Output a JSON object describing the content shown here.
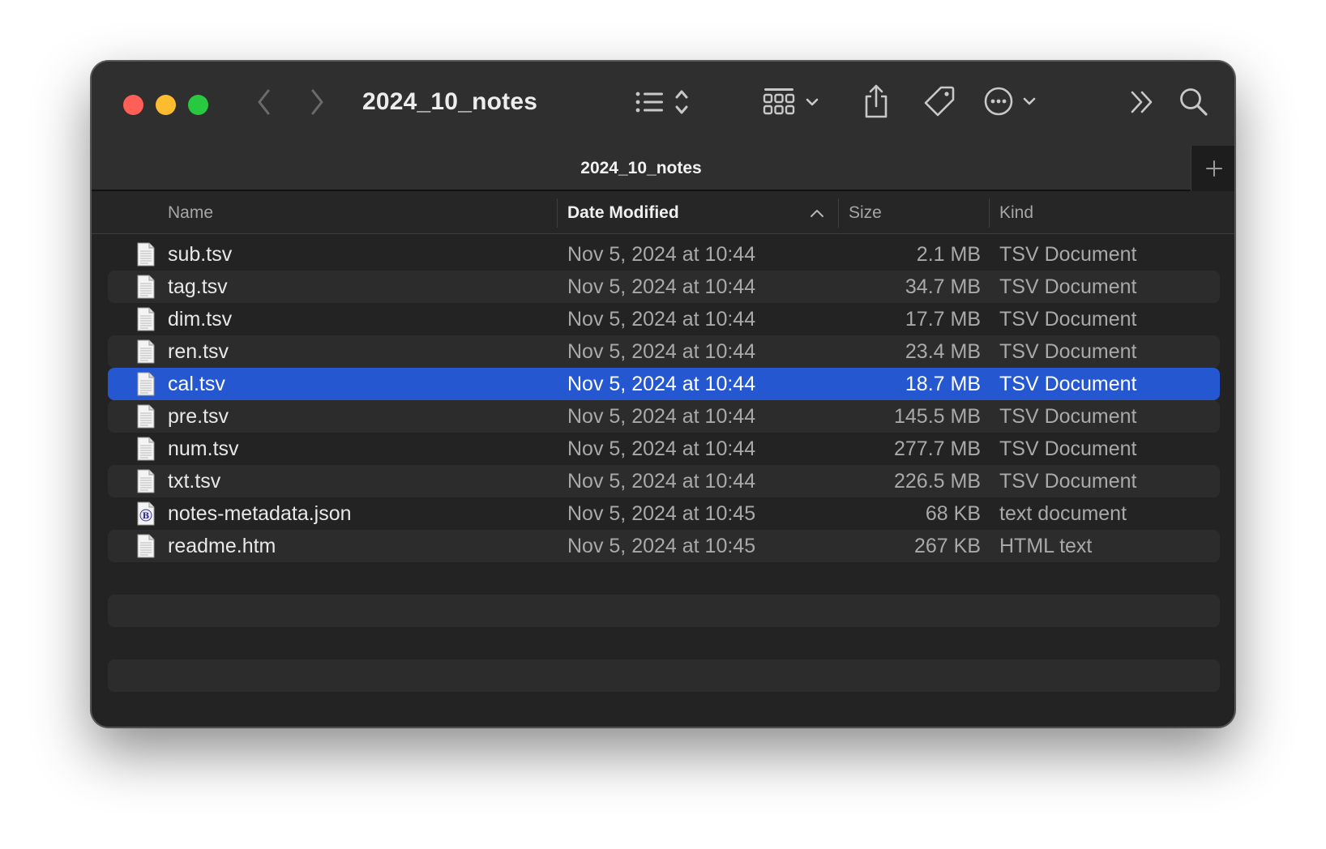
{
  "window": {
    "title": "2024_10_notes"
  },
  "toolbar": {
    "buttons": [
      {
        "name": "back",
        "icon": "chevron-left-icon"
      },
      {
        "name": "forward",
        "icon": "chevron-right-icon"
      },
      {
        "name": "view-list",
        "icon": "list-view-icon"
      },
      {
        "name": "group",
        "icon": "grid-group-icon"
      },
      {
        "name": "share",
        "icon": "share-icon"
      },
      {
        "name": "tag",
        "icon": "tag-icon"
      },
      {
        "name": "action",
        "icon": "ellipsis-circle-icon"
      },
      {
        "name": "more",
        "icon": "double-chevron-icon"
      },
      {
        "name": "search",
        "icon": "search-icon"
      }
    ]
  },
  "tabs": {
    "active": "2024_10_notes",
    "add_icon": "plus-icon"
  },
  "columns": {
    "name": "Name",
    "date": "Date Modified",
    "size": "Size",
    "kind": "Kind",
    "sorted_by": "Date Modified",
    "sort_direction": "ascending"
  },
  "files": [
    {
      "name": "sub.tsv",
      "date": "Nov 5, 2024 at 10:44",
      "size": "2.1 MB",
      "kind": "TSV Document",
      "icon": "document-icon"
    },
    {
      "name": "tag.tsv",
      "date": "Nov 5, 2024 at 10:44",
      "size": "34.7 MB",
      "kind": "TSV Document",
      "icon": "document-icon"
    },
    {
      "name": "dim.tsv",
      "date": "Nov 5, 2024 at 10:44",
      "size": "17.7 MB",
      "kind": "TSV Document",
      "icon": "document-icon"
    },
    {
      "name": "ren.tsv",
      "date": "Nov 5, 2024 at 10:44",
      "size": "23.4 MB",
      "kind": "TSV Document",
      "icon": "document-icon"
    },
    {
      "name": "cal.tsv",
      "date": "Nov 5, 2024 at 10:44",
      "size": "18.7 MB",
      "kind": "TSV Document",
      "icon": "document-icon",
      "selected": true
    },
    {
      "name": "pre.tsv",
      "date": "Nov 5, 2024 at 10:44",
      "size": "145.5 MB",
      "kind": "TSV Document",
      "icon": "document-icon"
    },
    {
      "name": "num.tsv",
      "date": "Nov 5, 2024 at 10:44",
      "size": "277.7 MB",
      "kind": "TSV Document",
      "icon": "document-icon"
    },
    {
      "name": "txt.tsv",
      "date": "Nov 5, 2024 at 10:44",
      "size": "226.5 MB",
      "kind": "TSV Document",
      "icon": "document-icon"
    },
    {
      "name": "notes-metadata.json",
      "date": "Nov 5, 2024 at 10:45",
      "size": "68 KB",
      "kind": "text document",
      "icon": "bbedit-document-icon"
    },
    {
      "name": "readme.htm",
      "date": "Nov 5, 2024 at 10:45",
      "size": "267 KB",
      "kind": "HTML text",
      "icon": "document-icon"
    }
  ],
  "colors": {
    "window_bg": "#232323",
    "toolbar_bg": "#2f2f2f",
    "selection": "#2557d0",
    "alt_row": "#2c2c2c",
    "close": "#fe5f57",
    "minimize": "#febc2e",
    "zoom": "#28c840"
  }
}
